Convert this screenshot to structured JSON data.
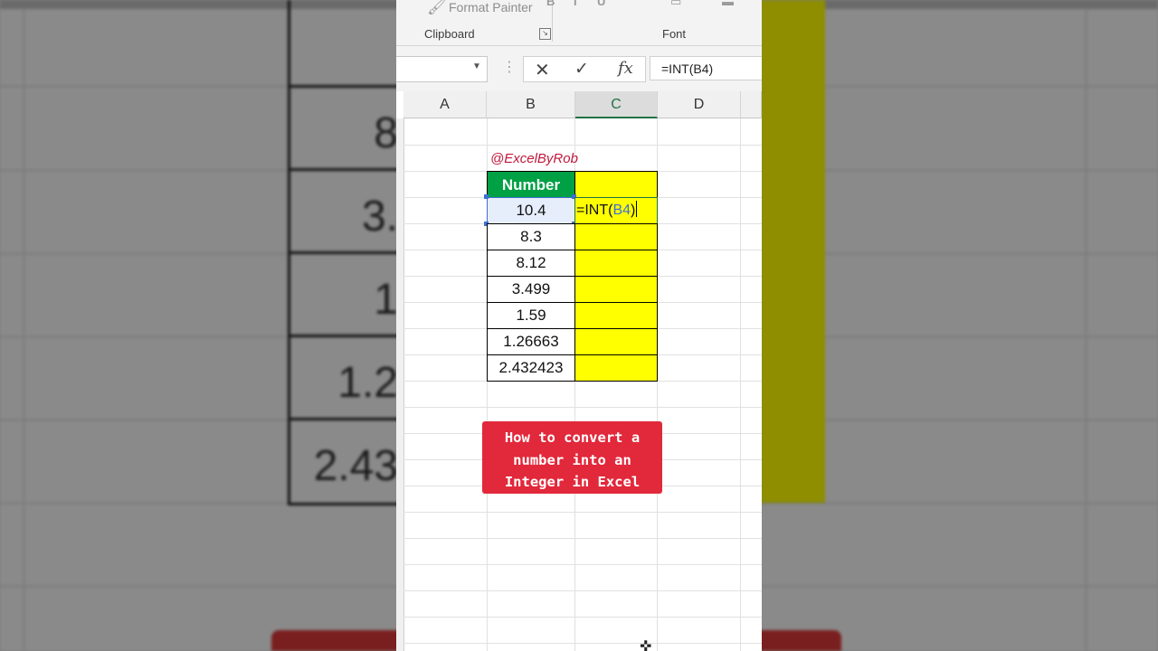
{
  "ribbon": {
    "format_painter": "Format Painter",
    "groups": [
      "Clipboard",
      "Font"
    ]
  },
  "formula_bar": {
    "cancel_icon": "✕",
    "enter_icon": "✓",
    "fx_label": "fx",
    "formula": "=INT(B4)"
  },
  "columns": [
    "A",
    "B",
    "C",
    "D"
  ],
  "selected_column": "C",
  "watermark": "@ExcelByRob",
  "table": {
    "header": "Number",
    "values": [
      "10.4",
      "8.3",
      "8.12",
      "3.499",
      "1.59",
      "1.26663",
      "2.432423"
    ]
  },
  "edit_cell": {
    "prefix": "=INT(",
    "ref": "B4",
    "suffix": ")"
  },
  "banner": {
    "lines": [
      "How to convert a",
      "number into an",
      "Integer in Excel"
    ]
  },
  "background": {
    "numbers": [
      "8",
      "3.",
      "1",
      "1.2",
      "2.43"
    ]
  },
  "colors": {
    "header_green": "#00a045",
    "highlight_yellow": "#ffff00",
    "banner_red": "#e2283b",
    "watermark_red": "#c0183c",
    "excel_green": "#217346",
    "selection_blue": "#3d6fd6"
  }
}
